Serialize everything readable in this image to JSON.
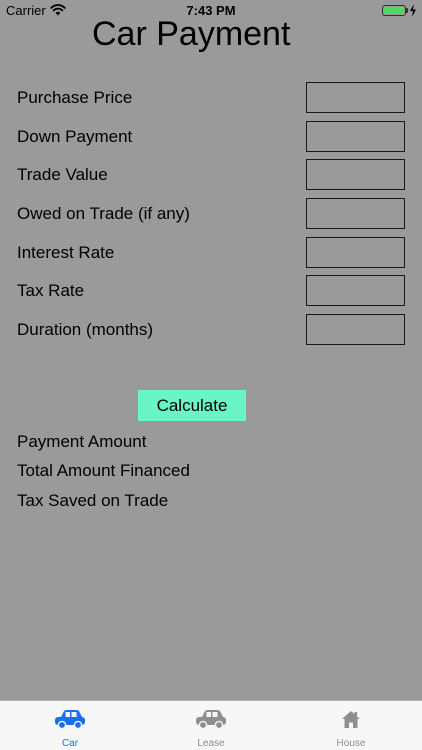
{
  "status_bar": {
    "carrier": "Carrier",
    "time": "7:43 PM",
    "battery_level": 1.0,
    "battery_color": "#4cd964"
  },
  "title": "Car Payment",
  "form": {
    "fields": [
      {
        "label": "Purchase Price",
        "value": ""
      },
      {
        "label": "Down Payment",
        "value": ""
      },
      {
        "label": "Trade Value",
        "value": ""
      },
      {
        "label": "Owed on Trade (if any)",
        "value": ""
      },
      {
        "label": "Interest Rate",
        "value": ""
      },
      {
        "label": "Tax Rate",
        "value": ""
      },
      {
        "label": "Duration (months)",
        "value": ""
      }
    ]
  },
  "calculate_button": {
    "label": "Calculate",
    "color": "#69f5c6"
  },
  "results": [
    {
      "label": "Payment Amount"
    },
    {
      "label": "Total Amount Financed"
    },
    {
      "label": "Tax Saved on Trade"
    }
  ],
  "tab_bar": {
    "active_color": "#1a6ef5",
    "inactive_color": "#8e8e93",
    "tabs": [
      {
        "label": "Car",
        "icon": "car-icon",
        "active": true
      },
      {
        "label": "Lease",
        "icon": "car-icon",
        "active": false
      },
      {
        "label": "House",
        "icon": "house-icon",
        "active": false
      }
    ]
  }
}
